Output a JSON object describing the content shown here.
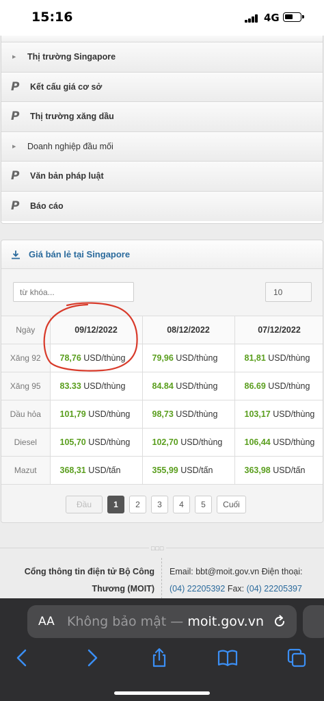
{
  "status_bar": {
    "time": "15:16",
    "network": "4G"
  },
  "menu": {
    "items": [
      {
        "icon": "arrow",
        "label": "Thị trường Singapore",
        "bold": true
      },
      {
        "icon": "p",
        "label": "Kết cấu giá cơ sở",
        "bold": true
      },
      {
        "icon": "p",
        "label": "Thị trường xăng dầu",
        "bold": true
      },
      {
        "icon": "arrow",
        "label": "Doanh nghiệp đầu mối",
        "bold": false
      },
      {
        "icon": "p",
        "label": "Văn bản pháp luật",
        "bold": true
      },
      {
        "icon": "p",
        "label": "Báo cáo",
        "bold": true
      }
    ]
  },
  "price_panel": {
    "title": "Giá bán lẻ tại Singapore",
    "search_placeholder": "từ khóa...",
    "page_size": "10",
    "table": {
      "corner": "Ngày",
      "dates": [
        "09/12/2022",
        "08/12/2022",
        "07/12/2022"
      ],
      "rows": [
        {
          "label": "Xăng 92",
          "cells": [
            {
              "num": "78,76",
              "unit": "USD/thùng"
            },
            {
              "num": "79,96",
              "unit": "USD/thùng"
            },
            {
              "num": "81,81",
              "unit": "USD/thùng"
            }
          ]
        },
        {
          "label": "Xăng 95",
          "cells": [
            {
              "num": "83.33",
              "unit": "USD/thùng"
            },
            {
              "num": "84.84",
              "unit": "USD/thùng"
            },
            {
              "num": "86.69",
              "unit": "USD/thùng"
            }
          ]
        },
        {
          "label": "Dầu hỏa",
          "cells": [
            {
              "num": "101,79",
              "unit": "USD/thùng"
            },
            {
              "num": "98,73",
              "unit": "USD/thùng"
            },
            {
              "num": "103,17",
              "unit": "USD/thùng"
            }
          ]
        },
        {
          "label": "Diesel",
          "cells": [
            {
              "num": "105,70",
              "unit": "USD/thùng"
            },
            {
              "num": "102,70",
              "unit": "USD/thùng"
            },
            {
              "num": "106,44",
              "unit": "USD/thùng"
            }
          ]
        },
        {
          "label": "Mazut",
          "cells": [
            {
              "num": "368,31",
              "unit": "USD/tấn"
            },
            {
              "num": "355,99",
              "unit": "USD/tấn"
            },
            {
              "num": "363,98",
              "unit": "USD/tấn"
            }
          ]
        }
      ]
    },
    "pager": {
      "first": "Đầu",
      "pages": [
        "1",
        "2",
        "3",
        "4",
        "5"
      ],
      "active": "1",
      "last": "Cuối"
    }
  },
  "footer": {
    "left_line1": "Cổng thông tin điện tử Bộ Công",
    "left_line2": "Thương (MOIT)",
    "email_line": "Email: bbt@moit.gov.vn Điện thoại:",
    "phone": "(04) 22205392",
    "fax_label": "Fax:",
    "fax": "(04) 22205397"
  },
  "safari": {
    "text_size_label": "AA",
    "url_insecure": "Không bảo mật —",
    "url_domain": "moit.gov.vn"
  },
  "colors": {
    "link": "#2a6a9c",
    "price": "#5a9e1e",
    "annotation": "#d83a2a",
    "safari_bar": "#2e2e30",
    "safari_accent": "#3b8ff5"
  }
}
